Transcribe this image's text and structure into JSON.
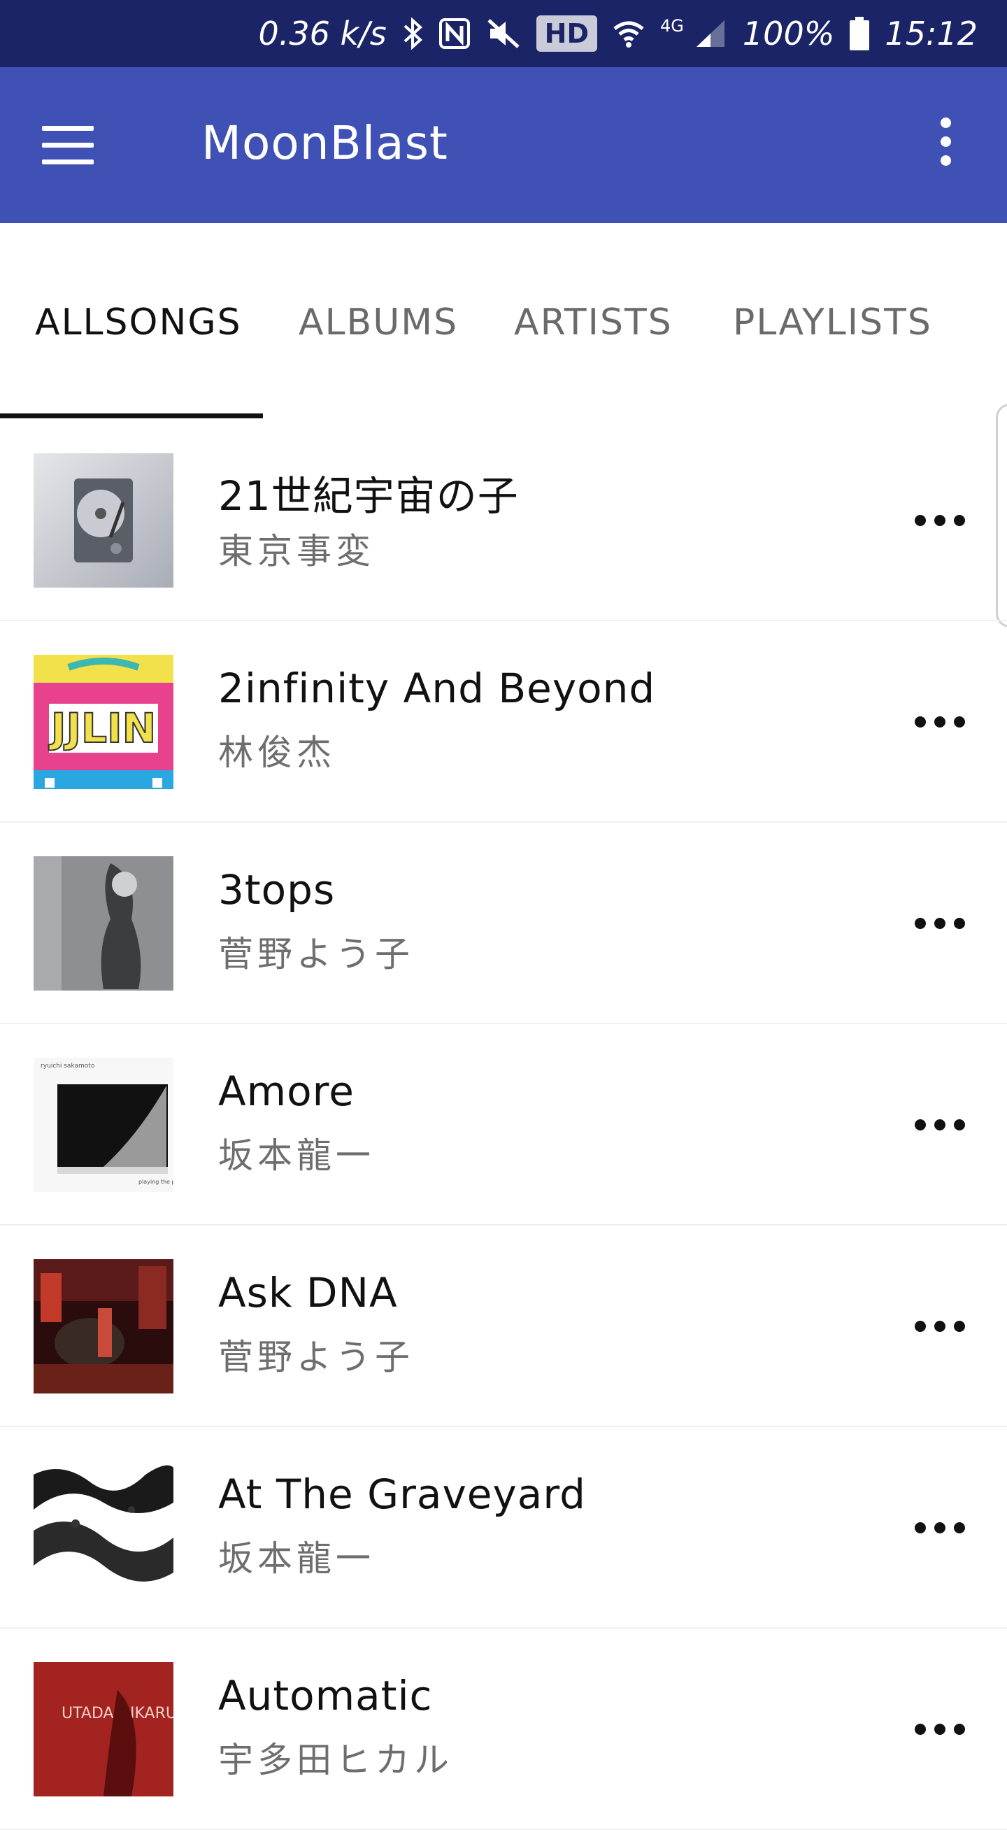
{
  "status_bar": {
    "net_speed": "0.36 k/s",
    "hd": "HD",
    "network": "4G",
    "battery": "100%",
    "time": "15:12"
  },
  "app_bar": {
    "title": "MoonBlast",
    "menu_icon": "hamburger-menu-icon",
    "overflow_icon": "more-vertical-icon",
    "color": "#3f51b5"
  },
  "tabs": [
    {
      "label": "ALLSONGS",
      "active": true
    },
    {
      "label": "ALBUMS",
      "active": false
    },
    {
      "label": "ARTISTS",
      "active": false
    },
    {
      "label": "PLAYLISTS",
      "active": false
    }
  ],
  "songs": [
    {
      "title": "21世紀宇宙の子",
      "artist": "東京事変"
    },
    {
      "title": "2infinity And Beyond",
      "artist": "林俊杰"
    },
    {
      "title": "3tops",
      "artist": "菅野よう子"
    },
    {
      "title": "Amore",
      "artist": "坂本龍一"
    },
    {
      "title": "Ask DNA",
      "artist": "菅野よう子"
    },
    {
      "title": "At The Graveyard",
      "artist": "坂本龍一"
    },
    {
      "title": "Automatic",
      "artist": "宇多田ヒカル"
    }
  ],
  "cover_texts": {
    "jjlin": "JJLIN",
    "sakamoto": "ryuichi sakamoto",
    "playing": "playing the piano",
    "utada": "UTADA HIKARU WILD LIFE"
  },
  "colors": {
    "status_bar": "#1b2467",
    "app_bar": "#3f51b5",
    "tab_active": "#111111",
    "tab_inactive": "#6a6a6a"
  }
}
